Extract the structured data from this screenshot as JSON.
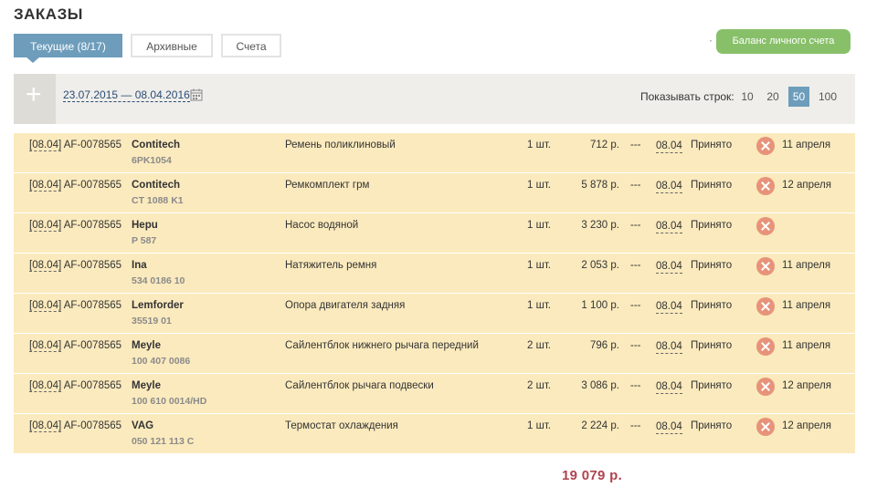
{
  "page_title": "ЗАКАЗЫ",
  "tabs": [
    {
      "label": "Текущие (8/17)",
      "active": true
    },
    {
      "label": "Архивные",
      "active": false
    },
    {
      "label": "Счета",
      "active": false
    }
  ],
  "dot": "·",
  "balance_button": "Баланс личного счета",
  "toolbar": {
    "add_icon": "+",
    "date_range": "23.07.2015 — 08.04.2016",
    "calendar_icon": "calendar-icon",
    "rows_label": "Показывать строк:",
    "page_sizes": [
      "10",
      "20",
      "50",
      "100"
    ],
    "page_size_active": "50"
  },
  "orders": [
    {
      "date": "[08.04]",
      "order_id": "AF-0078565",
      "brand": "Contitech",
      "part_no": "6PK1054",
      "name": "Ремень поликлиновый",
      "qty": "1 шт.",
      "price": "712 р.",
      "dash": "---",
      "delivery": "08.04",
      "status": "Принято",
      "when": "11 апреля"
    },
    {
      "date": "[08.04]",
      "order_id": "AF-0078565",
      "brand": "Contitech",
      "part_no": "CT 1088 K1",
      "name": "Ремкомплект грм",
      "qty": "1 шт.",
      "price": "5 878 р.",
      "dash": "---",
      "delivery": "08.04",
      "status": "Принято",
      "when": "12 апреля"
    },
    {
      "date": "[08.04]",
      "order_id": "AF-0078565",
      "brand": "Hepu",
      "part_no": "P 587",
      "name": "Насос водяной",
      "qty": "1 шт.",
      "price": "3 230 р.",
      "dash": "---",
      "delivery": "08.04",
      "status": "Принято",
      "when": ""
    },
    {
      "date": "[08.04]",
      "order_id": "AF-0078565",
      "brand": "Ina",
      "part_no": "534 0186 10",
      "name": "Натяжитель ремня",
      "qty": "1 шт.",
      "price": "2 053 р.",
      "dash": "---",
      "delivery": "08.04",
      "status": "Принято",
      "when": "11 апреля"
    },
    {
      "date": "[08.04]",
      "order_id": "AF-0078565",
      "brand": "Lemforder",
      "part_no": "35519 01",
      "name": "Опора двигателя задняя",
      "qty": "1 шт.",
      "price": "1 100 р.",
      "dash": "---",
      "delivery": "08.04",
      "status": "Принято",
      "when": "11 апреля"
    },
    {
      "date": "[08.04]",
      "order_id": "AF-0078565",
      "brand": "Meyle",
      "part_no": "100 407 0086",
      "name": "Сайлентблок нижнего рычага передний",
      "qty": "2 шт.",
      "price": "796 р.",
      "dash": "---",
      "delivery": "08.04",
      "status": "Принято",
      "when": "11 апреля"
    },
    {
      "date": "[08.04]",
      "order_id": "AF-0078565",
      "brand": "Meyle",
      "part_no": "100 610 0014/HD",
      "name": "Сайлентблок рычага подвески",
      "qty": "2 шт.",
      "price": "3 086 р.",
      "dash": "---",
      "delivery": "08.04",
      "status": "Принято",
      "when": "12 апреля"
    },
    {
      "date": "[08.04]",
      "order_id": "AF-0078565",
      "brand": "VAG",
      "part_no": "050 121 113 C",
      "name": "Термостат охлаждения",
      "qty": "1 шт.",
      "price": "2 224 р.",
      "dash": "---",
      "delivery": "08.04",
      "status": "Принято",
      "when": "12 апреля"
    }
  ],
  "total": "19 079 р.",
  "colors": {
    "accent": "#6d9dbb",
    "balance": "#88c06a",
    "row_bg": "#fbeabd",
    "cancel": "#e7937a",
    "total": "#b0434f"
  }
}
